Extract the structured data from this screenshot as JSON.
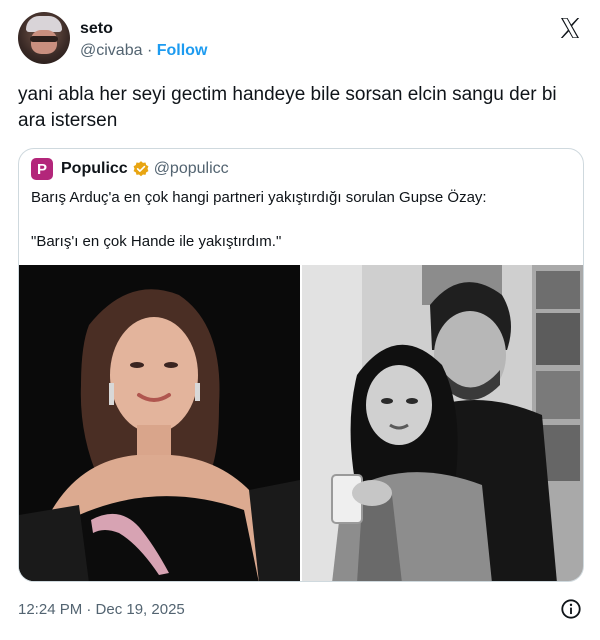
{
  "author": {
    "name": "seto",
    "handle": "@civaba",
    "separator": "·",
    "follow_label": "Follow"
  },
  "tweet": {
    "text": "yani abla her seyi gectim handeye bile sorsan elcin sangu der bi ara istersen"
  },
  "quoted": {
    "logo_letter": "P",
    "name": "Populicc",
    "handle": "@populicc",
    "text_line1": "Barış Arduç'a en çok hangi partneri yakıştırdığı sorulan Gupse Özay:",
    "text_line2": "\"Barış'ı en çok Hande ile yakıştırdım.\"",
    "brand_color": "#b3267a"
  },
  "icons": {
    "platform": "x-logo-icon",
    "verified": "verified-badge-icon",
    "info": "info-icon"
  },
  "footer": {
    "timestamp": "12:24 PM · Dec 19, 2025"
  },
  "colors": {
    "text": "#0f1419",
    "secondary": "#536471",
    "link": "#1d9bf0",
    "border": "#cfd9de",
    "badge": "#e8a512"
  }
}
